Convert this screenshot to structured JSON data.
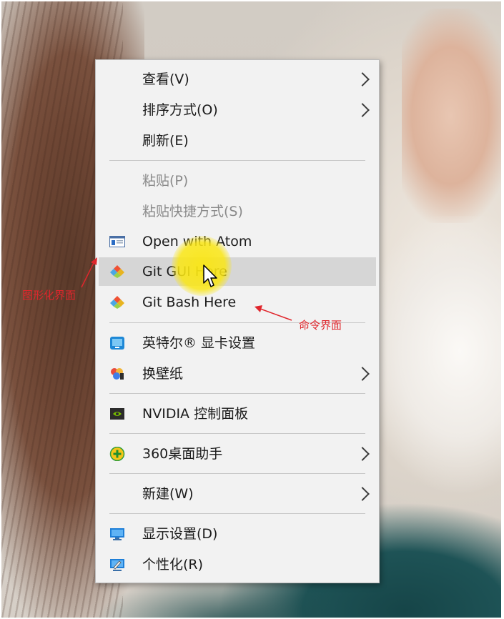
{
  "menu": {
    "view": "查看(V)",
    "sort_by": "排序方式(O)",
    "refresh": "刷新(E)",
    "paste": "粘贴(P)",
    "paste_shortcut": "粘贴快捷方式(S)",
    "open_with_atom": "Open with Atom",
    "git_gui_here": "Git GUI Here",
    "git_bash_here": "Git Bash Here",
    "intel_graphics": "英特尔® 显卡设置",
    "change_wallpaper": "换壁纸",
    "nvidia_control_panel": "NVIDIA 控制面板",
    "desktop_assistant_360": "360桌面助手",
    "new": "新建(W)",
    "display_settings": "显示设置(D)",
    "personalize": "个性化(R)"
  },
  "annotations": {
    "gui_label": "图形化界面",
    "cmd_label": "命令界面"
  },
  "colors": {
    "menu_background": "#f2f2f2",
    "highlight_row": "#d6d6d6",
    "disabled_text": "#8a8a8a",
    "annotation_red": "#e0262c",
    "cursor_highlight": "#fae614"
  },
  "icons": {
    "open_with_atom": "window-icon",
    "git_gui_here": "git-diamond-icon",
    "git_bash_here": "git-diamond-icon",
    "intel_graphics": "intel-graphics-icon",
    "change_wallpaper": "wallpaper-icon",
    "nvidia_control_panel": "nvidia-icon",
    "desktop_assistant_360": "plus-circle-icon",
    "display_settings": "monitor-icon",
    "personalize": "personalize-icon"
  }
}
